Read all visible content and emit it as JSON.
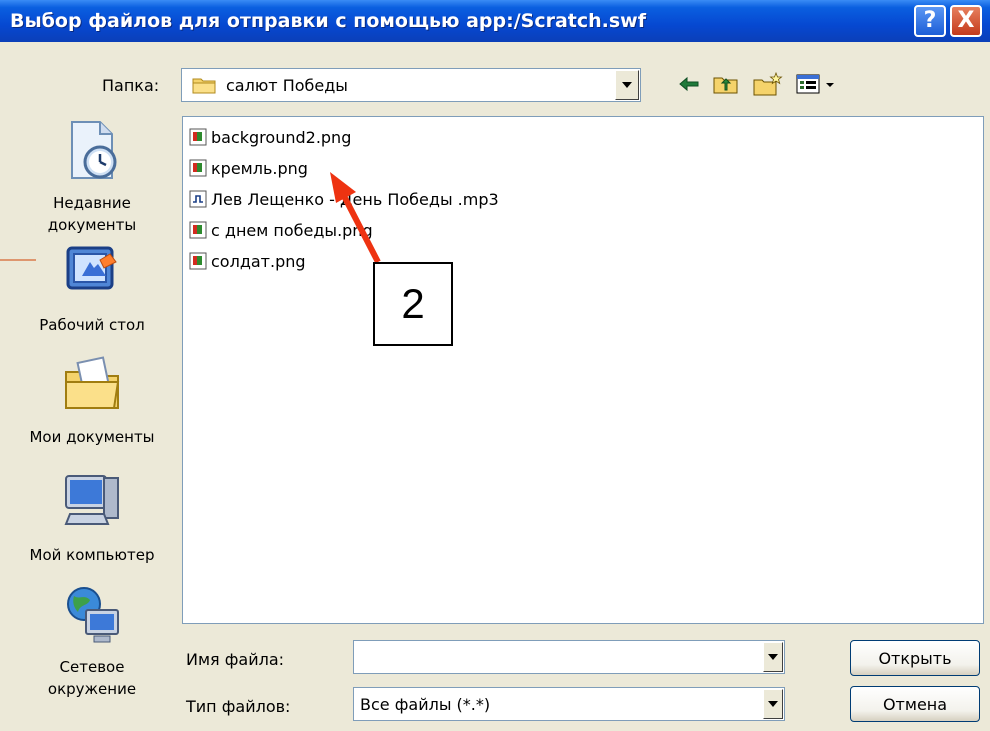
{
  "window": {
    "title": "Выбор файлов для отправки с помощью app:/Scratch.swf",
    "help_glyph": "?",
    "close_glyph": "X"
  },
  "toolbar": {
    "folder_label": "Папка:",
    "folder_value": "салют Победы",
    "icons": [
      "back-arrow-icon",
      "up-folder-icon",
      "new-folder-icon",
      "view-menu-icon"
    ]
  },
  "sidebar": {
    "items": [
      {
        "label_line1": "Недавние",
        "label_line2": "документы",
        "icon": "recent-documents-icon"
      },
      {
        "label_line1": "Рабочий стол",
        "label_line2": "",
        "icon": "desktop-icon"
      },
      {
        "label_line1": "Мои документы",
        "label_line2": "",
        "icon": "my-documents-icon"
      },
      {
        "label_line1": "Мой компьютер",
        "label_line2": "",
        "icon": "my-computer-icon"
      },
      {
        "label_line1": "Сетевое",
        "label_line2": "окружение",
        "icon": "network-icon"
      }
    ]
  },
  "files": [
    {
      "name": "background2.png",
      "type": "image"
    },
    {
      "name": "кремль.png",
      "type": "image"
    },
    {
      "name": "Лев Лещенко - День Победы .mp3",
      "type": "audio"
    },
    {
      "name": "с днем победы.png",
      "type": "image"
    },
    {
      "name": "солдат.png",
      "type": "image"
    }
  ],
  "form": {
    "filename_label": "Имя файла:",
    "filename_value": "",
    "filetype_label": "Тип файлов:",
    "filetype_value": "Все файлы (*.*)",
    "open_button": "Открыть",
    "cancel_button": "Отмена"
  },
  "annotation": {
    "number": "2",
    "color": "#ee3311"
  }
}
